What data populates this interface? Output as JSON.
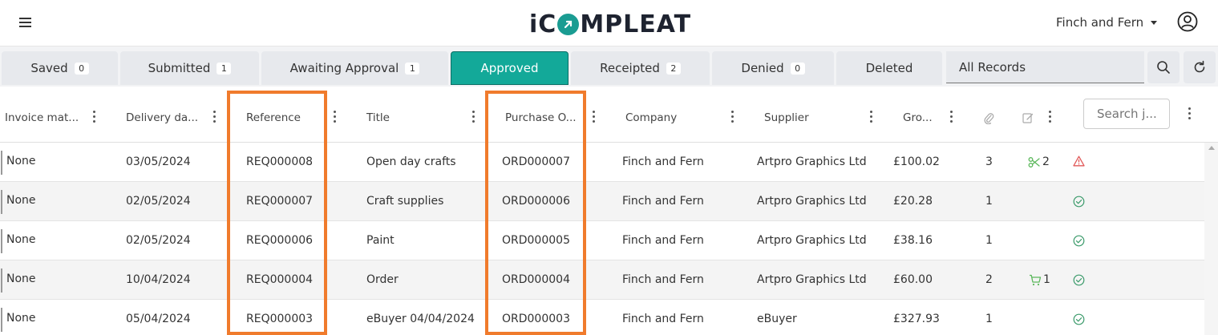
{
  "header": {
    "logo_text": "iCOMPLEAT",
    "account_name": "Finch and Fern",
    "brand_color": "#13a999"
  },
  "tabs": [
    {
      "label": "Saved",
      "count": "0"
    },
    {
      "label": "Submitted",
      "count": "1"
    },
    {
      "label": "Awaiting Approval",
      "count": "1"
    },
    {
      "label": "Approved",
      "count": null
    },
    {
      "label": "Receipted",
      "count": "2"
    },
    {
      "label": "Denied",
      "count": "0"
    },
    {
      "label": "Deleted",
      "count": null
    }
  ],
  "active_tab": "Approved",
  "records_filter": "All Records",
  "columns": [
    "Invoice mat...",
    "Delivery da...",
    "Reference",
    "Title",
    "Purchase O...",
    "Company",
    "Supplier",
    "Gro..."
  ],
  "search": {
    "placeholder": "Search j..."
  },
  "rows": [
    {
      "invoice": "None",
      "delivery": "03/05/2024",
      "reference": "REQ000008",
      "title": "Open day crafts",
      "purchase": "ORD000007",
      "company": "Finch and Fern",
      "supplier": "Artpro Graphics Ltd",
      "gross": "£100.02",
      "attachments": "3",
      "extra_icon": "scissors-icon",
      "extra_count": "2",
      "status": "warning-icon"
    },
    {
      "invoice": "None",
      "delivery": "02/05/2024",
      "reference": "REQ000007",
      "title": "Craft supplies",
      "purchase": "ORD000006",
      "company": "Finch and Fern",
      "supplier": "Artpro Graphics Ltd",
      "gross": "£20.28",
      "attachments": "1",
      "extra_icon": null,
      "extra_count": "",
      "status": "check-circle-icon"
    },
    {
      "invoice": "None",
      "delivery": "02/05/2024",
      "reference": "REQ000006",
      "title": "Paint",
      "purchase": "ORD000005",
      "company": "Finch and Fern",
      "supplier": "Artpro Graphics Ltd",
      "gross": "£38.16",
      "attachments": "1",
      "extra_icon": null,
      "extra_count": "",
      "status": "check-circle-icon"
    },
    {
      "invoice": "None",
      "delivery": "10/04/2024",
      "reference": "REQ000004",
      "title": "Order",
      "purchase": "ORD000004",
      "company": "Finch and Fern",
      "supplier": "Artpro Graphics Ltd",
      "gross": "£60.00",
      "attachments": "2",
      "extra_icon": "cart-icon",
      "extra_count": "1",
      "status": "check-circle-icon"
    },
    {
      "invoice": "None",
      "delivery": "05/04/2024",
      "reference": "REQ000003",
      "title": "eBuyer 04/04/2024",
      "purchase": "ORD000003",
      "company": "Finch and Fern",
      "supplier": "eBuyer",
      "gross": "£327.93",
      "attachments": "1",
      "extra_icon": null,
      "extra_count": "",
      "status": "check-circle-icon"
    }
  ]
}
